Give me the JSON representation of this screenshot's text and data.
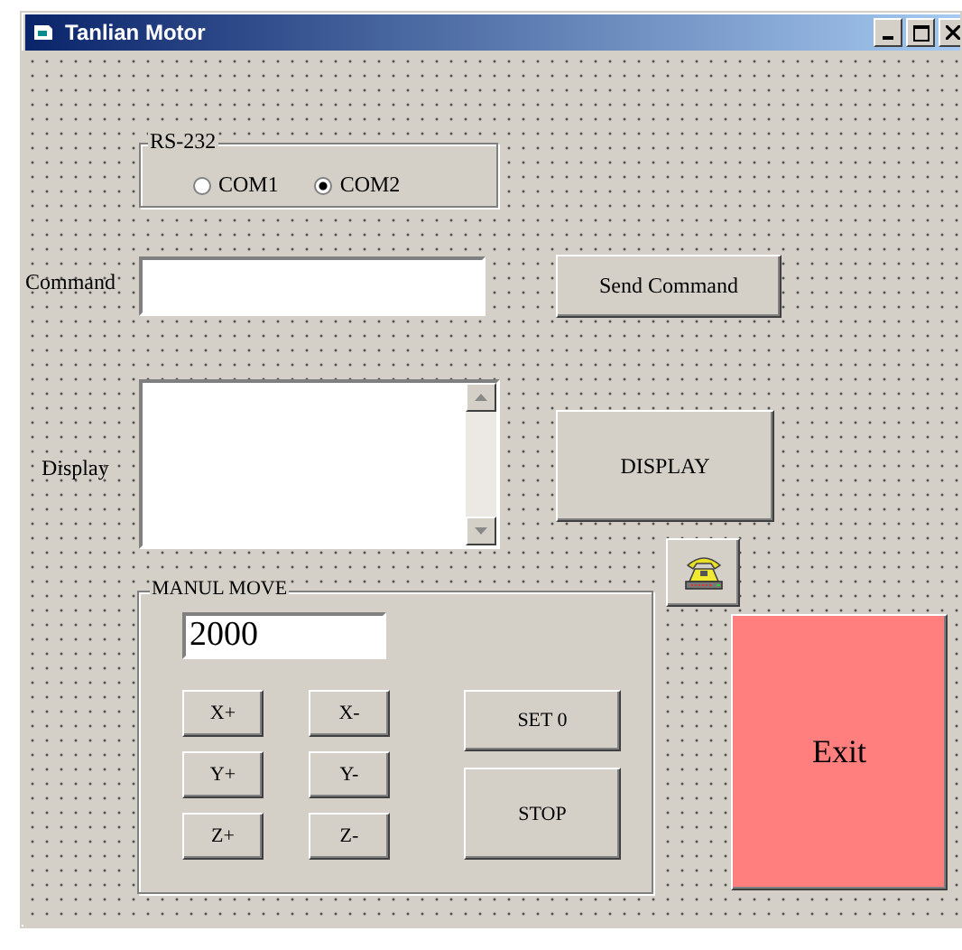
{
  "window": {
    "title": "Tanlian Motor"
  },
  "port_group": {
    "label": "RS-232",
    "options": [
      {
        "label": "COM1",
        "selected": false
      },
      {
        "label": "COM2",
        "selected": true
      }
    ]
  },
  "command": {
    "label": "Command"
  },
  "send_button": "Send Command",
  "display": {
    "label": "Display"
  },
  "display_button": "DISPLAY",
  "manual_move": {
    "label": "MANUL MOVE",
    "step_value": "2000",
    "axis_buttons": [
      "X+",
      "X-",
      "Y+",
      "Y-",
      "Z+",
      "Z-"
    ],
    "set_zero_button": "SET 0",
    "stop_button": "STOP"
  },
  "exit_button": "Exit"
}
